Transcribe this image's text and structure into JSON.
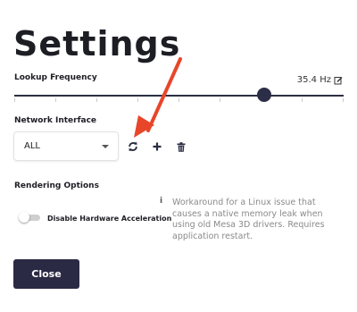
{
  "page": {
    "title": "Settings"
  },
  "lookup": {
    "label": "Lookup Frequency",
    "value": "35.4 Hz",
    "slider_fraction": 0.76
  },
  "network": {
    "label": "Network Interface",
    "selected": "ALL",
    "icons": [
      "refresh-icon",
      "plus-icon",
      "trash-icon"
    ]
  },
  "rendering": {
    "label": "Rendering Options",
    "toggle_label": "Disable Hardware Acceleration",
    "toggle_on": false,
    "info": "Workaround for a Linux issue that causes a native memory leak when using old Mesa 3D drivers. Requires application restart."
  },
  "actions": {
    "close": "Close"
  },
  "colors": {
    "primary": "#2a2a44",
    "annotation": "#e8462a"
  }
}
